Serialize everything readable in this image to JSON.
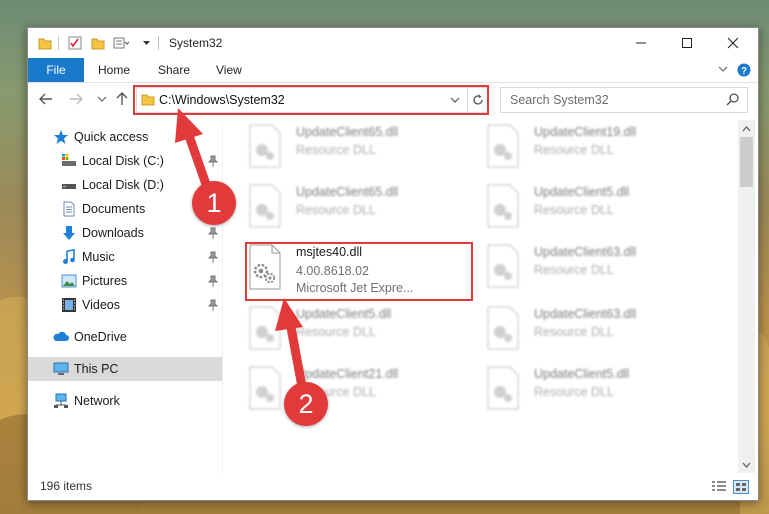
{
  "window": {
    "title": "System32"
  },
  "ribbon": {
    "file": "File",
    "tabs": [
      "Home",
      "Share",
      "View"
    ]
  },
  "address": {
    "path": "C:\\Windows\\System32"
  },
  "search": {
    "placeholder": "Search System32"
  },
  "sidebar": {
    "items": [
      {
        "label": "Quick access",
        "icon": "star-icon",
        "pinned": false
      },
      {
        "label": "Local Disk (C:)",
        "icon": "drive-icon",
        "pinned": true
      },
      {
        "label": "Local Disk (D:)",
        "icon": "drive-icon",
        "pinned": false
      },
      {
        "label": "Documents",
        "icon": "document-icon",
        "pinned": true
      },
      {
        "label": "Downloads",
        "icon": "download-icon",
        "pinned": true
      },
      {
        "label": "Music",
        "icon": "music-icon",
        "pinned": true
      },
      {
        "label": "Pictures",
        "icon": "pictures-icon",
        "pinned": true
      },
      {
        "label": "Videos",
        "icon": "video-icon",
        "pinned": true
      },
      {
        "label": "OneDrive",
        "icon": "cloud-icon",
        "pinned": false
      },
      {
        "label": "This PC",
        "icon": "computer-icon",
        "pinned": false,
        "selected": true
      },
      {
        "label": "Network",
        "icon": "network-icon",
        "pinned": false
      }
    ]
  },
  "files": {
    "left": [
      {
        "name": "UpdateClient65.dll",
        "sub": "Resource DLL"
      },
      {
        "name": "UpdateClient65.dll",
        "sub": "Resource DLL"
      },
      {
        "name": "msjtes40.dll",
        "sub": "4.00.8618.02",
        "sub2": "Microsoft Jet Expre...",
        "highlighted": true
      },
      {
        "name": "UpdateClient5.dll",
        "sub": "Resource DLL"
      },
      {
        "name": "UpdateClient21.dll",
        "sub": "Resource DLL"
      }
    ],
    "right": [
      {
        "name": "UpdateClient19.dll",
        "sub": "Resource DLL"
      },
      {
        "name": "UpdateClient5.dll",
        "sub": "Resource DLL"
      },
      {
        "name": "UpdateClient63.dll",
        "sub": "Resource DLL"
      },
      {
        "name": "UpdateClient63.dll",
        "sub": "Resource DLL"
      },
      {
        "name": "UpdateClient5.dll",
        "sub": "Resource DLL"
      }
    ]
  },
  "status": {
    "items": "196 items"
  },
  "annotations": {
    "step1": "1",
    "step2": "2"
  },
  "colors": {
    "accent": "#1979ca",
    "annotation": "#e23a3a",
    "selected": "#d9d9d9"
  }
}
